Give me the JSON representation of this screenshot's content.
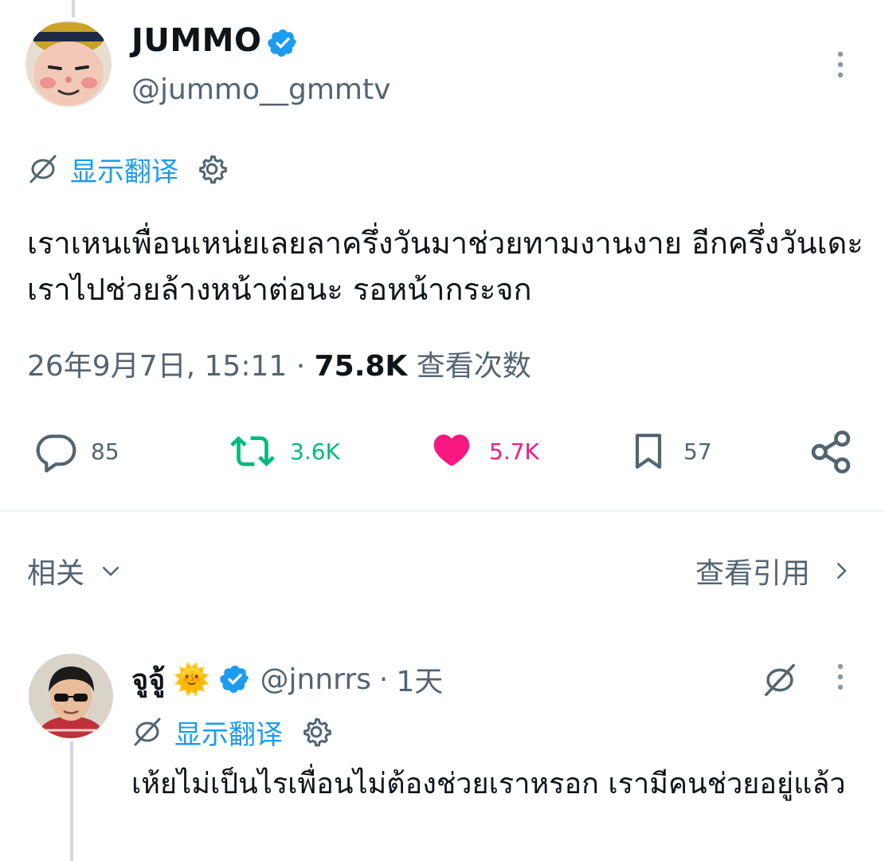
{
  "author": {
    "name": "JUMMO",
    "handle": "@jummo__gmmtv",
    "verified_color": "#1d9bf0"
  },
  "translate": {
    "label": "显示翻译"
  },
  "tweet": {
    "text": "เราเหนเพื่อนเหน่ยเลยลาครึ่งวันมาช่วยทามงานงาย อีกครึ่งวันเดะเราไปช่วยล้างหน้าต่อนะ รอหน้ากระจก",
    "timestamp": "26年9月7日, 15:11",
    "separator": " · ",
    "views_count": "75.8K",
    "views_label": "查看次数"
  },
  "actions": {
    "replies": "85",
    "reposts": "3.6K",
    "likes": "5.7K",
    "bookmarks": "57"
  },
  "colors": {
    "accent": "#1d9bf0",
    "repost": "#00ba7c",
    "like": "#f91880",
    "muted": "#536471"
  },
  "related": {
    "label": "相关",
    "quotes_label": "查看引用"
  },
  "reply": {
    "name": "จูจู้",
    "emoji": "🌞",
    "handle": "@jnnrrs",
    "dot": "·",
    "time": "1天",
    "translate_label": "显示翻译",
    "text": "เห้ยไม่เป็นไรเพื่อนไม่ต้องช่วยเราหรอก เรามีคนช่วยอยู่แล้ว"
  }
}
